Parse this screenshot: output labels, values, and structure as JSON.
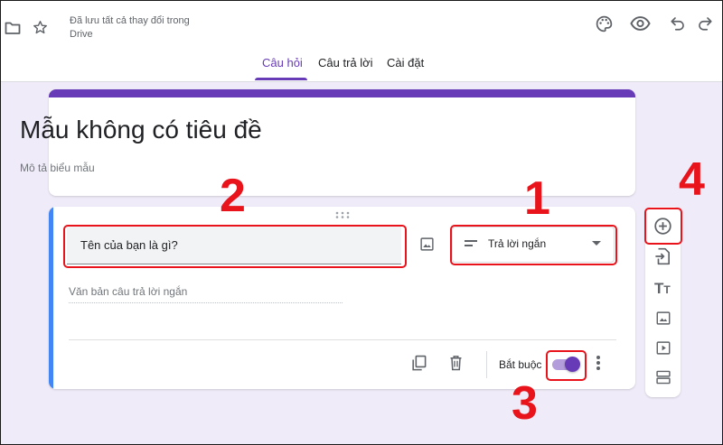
{
  "header": {
    "saved_line1": "Đã lưu tất cả thay đổi trong",
    "saved_line2": "Drive",
    "icons": [
      "folder-icon",
      "star-icon",
      "palette-icon",
      "preview-eye-icon",
      "undo-icon",
      "redo-icon"
    ]
  },
  "tabs": [
    {
      "label": "Câu hỏi",
      "active": true
    },
    {
      "label": "Câu trả lời",
      "active": false
    },
    {
      "label": "Cài đặt",
      "active": false
    }
  ],
  "form": {
    "title": "Mẫu không có tiêu đề",
    "description_placeholder": "Mô tả biểu mẫu"
  },
  "question": {
    "text": "Tên của bạn là gì?",
    "type": "Trả lời ngắn",
    "answer_placeholder": "Văn bản câu trả lời ngắn",
    "required_label": "Bắt buộc",
    "required": true
  },
  "side_tools": [
    "add-question-icon",
    "import-questions-icon",
    "add-title-icon",
    "add-image-icon",
    "add-video-icon",
    "add-section-icon"
  ],
  "annotations": [
    "1",
    "2",
    "3",
    "4"
  ],
  "colors": {
    "accent": "#673ab7",
    "question_accent": "#4285f4",
    "annotation": "#e8131b",
    "page_bg": "#f0ebf8"
  }
}
